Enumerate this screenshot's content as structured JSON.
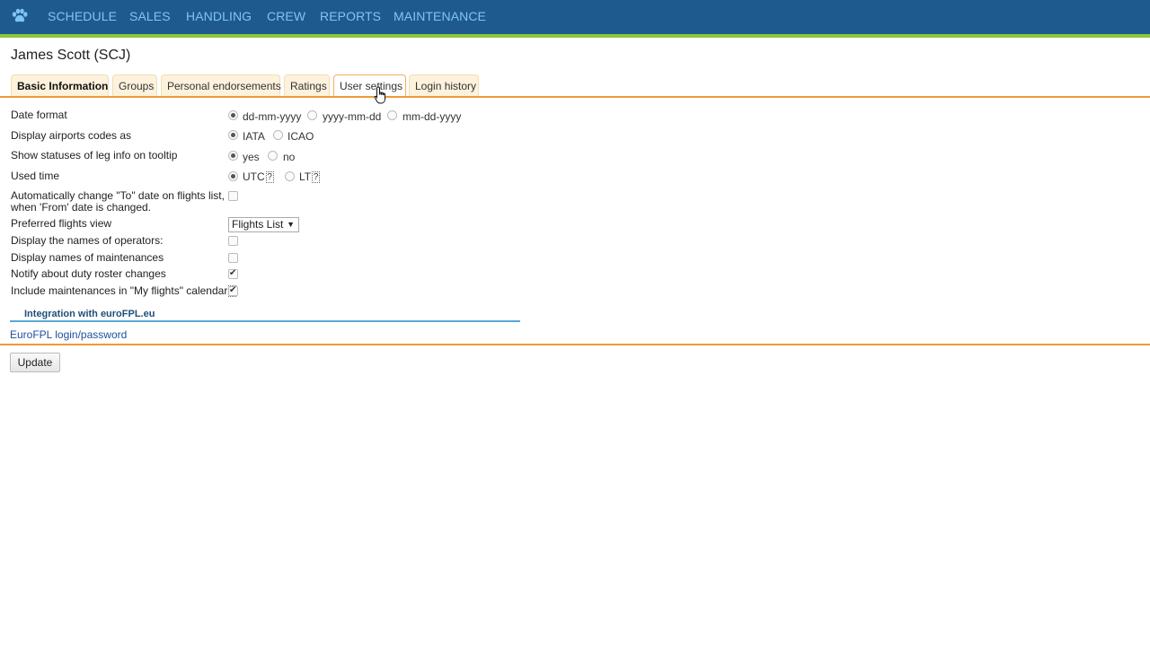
{
  "nav": {
    "logo_icon": "paw-icon",
    "items": [
      "SCHEDULE",
      "SALES",
      "HANDLING",
      "CREW",
      "REPORTS",
      "MAINTENANCE"
    ]
  },
  "page": {
    "title": "James Scott (SCJ)"
  },
  "tabs": [
    {
      "label": "Basic Information"
    },
    {
      "label": "Groups"
    },
    {
      "label": "Personal endorsements"
    },
    {
      "label": "Ratings"
    },
    {
      "label": "User settings"
    },
    {
      "label": "Login history"
    }
  ],
  "settings": {
    "date_format": {
      "label": "Date format",
      "options": [
        "dd-mm-yyyy",
        "yyyy-mm-dd",
        "mm-dd-yyyy"
      ],
      "selected": "dd-mm-yyyy"
    },
    "airport_codes": {
      "label": "Display airports codes as",
      "options": [
        "IATA",
        "ICAO"
      ],
      "selected": "IATA"
    },
    "leg_statuses": {
      "label": "Show statuses of leg info on tooltip",
      "options": [
        "yes",
        "no"
      ],
      "selected": "yes"
    },
    "used_time": {
      "label": "Used time",
      "options": [
        "UTC",
        "LT"
      ],
      "selected": "UTC",
      "help": "?"
    },
    "auto_change_to_date": {
      "label_line1": "Automatically change \"To\" date on flights list,",
      "label_line2": "when 'From' date is changed.",
      "checked": false
    },
    "preferred_view": {
      "label": "Preferred flights view",
      "value": "Flights List"
    },
    "operators_names": {
      "label": "Display the names of operators:",
      "checked": false
    },
    "maintenance_names": {
      "label": "Display names of maintenances",
      "checked": false
    },
    "notify_roster": {
      "label": "Notify about duty roster changes",
      "checked": true
    },
    "include_maintenances": {
      "label": "Include maintenances in \"My flights\" calendar",
      "help": "?",
      "checked": true
    }
  },
  "integration": {
    "title": "Integration with euroFPL.eu",
    "link": "EuroFPL login/password"
  },
  "actions": {
    "update_label": "Update"
  }
}
